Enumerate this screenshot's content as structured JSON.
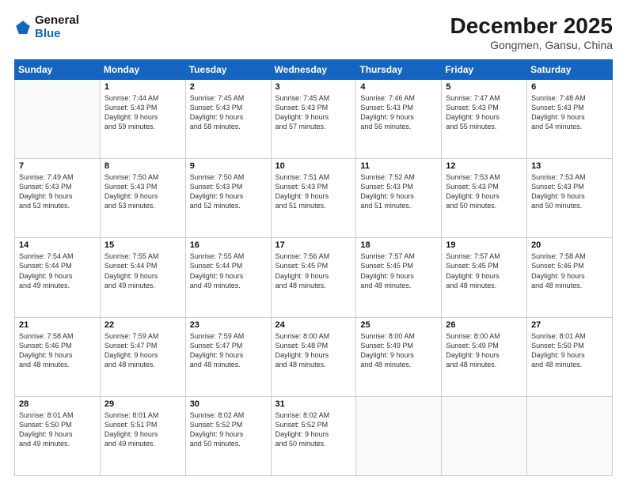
{
  "header": {
    "logo_general": "General",
    "logo_blue": "Blue",
    "title": "December 2025",
    "subtitle": "Gongmen, Gansu, China"
  },
  "weekdays": [
    "Sunday",
    "Monday",
    "Tuesday",
    "Wednesday",
    "Thursday",
    "Friday",
    "Saturday"
  ],
  "weeks": [
    [
      {
        "day": "",
        "sunrise": "",
        "sunset": "",
        "daylight": ""
      },
      {
        "day": "1",
        "sunrise": "Sunrise: 7:44 AM",
        "sunset": "Sunset: 5:43 PM",
        "daylight": "Daylight: 9 hours and 59 minutes."
      },
      {
        "day": "2",
        "sunrise": "Sunrise: 7:45 AM",
        "sunset": "Sunset: 5:43 PM",
        "daylight": "Daylight: 9 hours and 58 minutes."
      },
      {
        "day": "3",
        "sunrise": "Sunrise: 7:45 AM",
        "sunset": "Sunset: 5:43 PM",
        "daylight": "Daylight: 9 hours and 57 minutes."
      },
      {
        "day": "4",
        "sunrise": "Sunrise: 7:46 AM",
        "sunset": "Sunset: 5:43 PM",
        "daylight": "Daylight: 9 hours and 56 minutes."
      },
      {
        "day": "5",
        "sunrise": "Sunrise: 7:47 AM",
        "sunset": "Sunset: 5:43 PM",
        "daylight": "Daylight: 9 hours and 55 minutes."
      },
      {
        "day": "6",
        "sunrise": "Sunrise: 7:48 AM",
        "sunset": "Sunset: 5:43 PM",
        "daylight": "Daylight: 9 hours and 54 minutes."
      }
    ],
    [
      {
        "day": "7",
        "sunrise": "Sunrise: 7:49 AM",
        "sunset": "Sunset: 5:43 PM",
        "daylight": "Daylight: 9 hours and 53 minutes."
      },
      {
        "day": "8",
        "sunrise": "Sunrise: 7:50 AM",
        "sunset": "Sunset: 5:43 PM",
        "daylight": "Daylight: 9 hours and 53 minutes."
      },
      {
        "day": "9",
        "sunrise": "Sunrise: 7:50 AM",
        "sunset": "Sunset: 5:43 PM",
        "daylight": "Daylight: 9 hours and 52 minutes."
      },
      {
        "day": "10",
        "sunrise": "Sunrise: 7:51 AM",
        "sunset": "Sunset: 5:43 PM",
        "daylight": "Daylight: 9 hours and 51 minutes."
      },
      {
        "day": "11",
        "sunrise": "Sunrise: 7:52 AM",
        "sunset": "Sunset: 5:43 PM",
        "daylight": "Daylight: 9 hours and 51 minutes."
      },
      {
        "day": "12",
        "sunrise": "Sunrise: 7:53 AM",
        "sunset": "Sunset: 5:43 PM",
        "daylight": "Daylight: 9 hours and 50 minutes."
      },
      {
        "day": "13",
        "sunrise": "Sunrise: 7:53 AM",
        "sunset": "Sunset: 5:43 PM",
        "daylight": "Daylight: 9 hours and 50 minutes."
      }
    ],
    [
      {
        "day": "14",
        "sunrise": "Sunrise: 7:54 AM",
        "sunset": "Sunset: 5:44 PM",
        "daylight": "Daylight: 9 hours and 49 minutes."
      },
      {
        "day": "15",
        "sunrise": "Sunrise: 7:55 AM",
        "sunset": "Sunset: 5:44 PM",
        "daylight": "Daylight: 9 hours and 49 minutes."
      },
      {
        "day": "16",
        "sunrise": "Sunrise: 7:55 AM",
        "sunset": "Sunset: 5:44 PM",
        "daylight": "Daylight: 9 hours and 49 minutes."
      },
      {
        "day": "17",
        "sunrise": "Sunrise: 7:56 AM",
        "sunset": "Sunset: 5:45 PM",
        "daylight": "Daylight: 9 hours and 48 minutes."
      },
      {
        "day": "18",
        "sunrise": "Sunrise: 7:57 AM",
        "sunset": "Sunset: 5:45 PM",
        "daylight": "Daylight: 9 hours and 48 minutes."
      },
      {
        "day": "19",
        "sunrise": "Sunrise: 7:57 AM",
        "sunset": "Sunset: 5:45 PM",
        "daylight": "Daylight: 9 hours and 48 minutes."
      },
      {
        "day": "20",
        "sunrise": "Sunrise: 7:58 AM",
        "sunset": "Sunset: 5:46 PM",
        "daylight": "Daylight: 9 hours and 48 minutes."
      }
    ],
    [
      {
        "day": "21",
        "sunrise": "Sunrise: 7:58 AM",
        "sunset": "Sunset: 5:46 PM",
        "daylight": "Daylight: 9 hours and 48 minutes."
      },
      {
        "day": "22",
        "sunrise": "Sunrise: 7:59 AM",
        "sunset": "Sunset: 5:47 PM",
        "daylight": "Daylight: 9 hours and 48 minutes."
      },
      {
        "day": "23",
        "sunrise": "Sunrise: 7:59 AM",
        "sunset": "Sunset: 5:47 PM",
        "daylight": "Daylight: 9 hours and 48 minutes."
      },
      {
        "day": "24",
        "sunrise": "Sunrise: 8:00 AM",
        "sunset": "Sunset: 5:48 PM",
        "daylight": "Daylight: 9 hours and 48 minutes."
      },
      {
        "day": "25",
        "sunrise": "Sunrise: 8:00 AM",
        "sunset": "Sunset: 5:49 PM",
        "daylight": "Daylight: 9 hours and 48 minutes."
      },
      {
        "day": "26",
        "sunrise": "Sunrise: 8:00 AM",
        "sunset": "Sunset: 5:49 PM",
        "daylight": "Daylight: 9 hours and 48 minutes."
      },
      {
        "day": "27",
        "sunrise": "Sunrise: 8:01 AM",
        "sunset": "Sunset: 5:50 PM",
        "daylight": "Daylight: 9 hours and 48 minutes."
      }
    ],
    [
      {
        "day": "28",
        "sunrise": "Sunrise: 8:01 AM",
        "sunset": "Sunset: 5:50 PM",
        "daylight": "Daylight: 9 hours and 49 minutes."
      },
      {
        "day": "29",
        "sunrise": "Sunrise: 8:01 AM",
        "sunset": "Sunset: 5:51 PM",
        "daylight": "Daylight: 9 hours and 49 minutes."
      },
      {
        "day": "30",
        "sunrise": "Sunrise: 8:02 AM",
        "sunset": "Sunset: 5:52 PM",
        "daylight": "Daylight: 9 hours and 50 minutes."
      },
      {
        "day": "31",
        "sunrise": "Sunrise: 8:02 AM",
        "sunset": "Sunset: 5:52 PM",
        "daylight": "Daylight: 9 hours and 50 minutes."
      },
      {
        "day": "",
        "sunrise": "",
        "sunset": "",
        "daylight": ""
      },
      {
        "day": "",
        "sunrise": "",
        "sunset": "",
        "daylight": ""
      },
      {
        "day": "",
        "sunrise": "",
        "sunset": "",
        "daylight": ""
      }
    ]
  ]
}
